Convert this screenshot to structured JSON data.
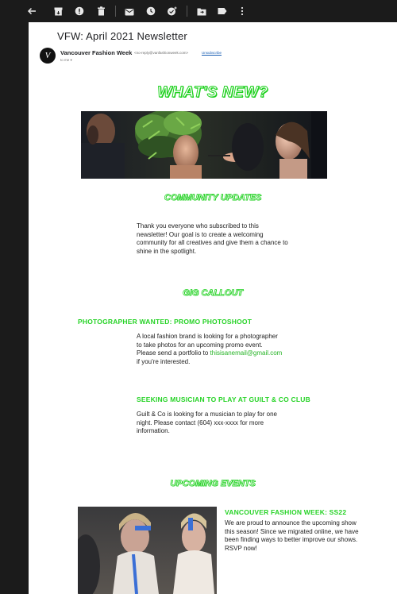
{
  "toolbar": {
    "icons": [
      "back-arrow-icon",
      "archive-icon",
      "report-spam-icon",
      "delete-icon",
      "mark-unread-icon",
      "snooze-icon",
      "add-task-icon",
      "move-to-icon",
      "label-icon",
      "more-options-icon"
    ]
  },
  "email": {
    "subject": "VFW: April 2021 Newsletter",
    "avatar_letter": "V",
    "sender_name": "Vancouver Fashion Week",
    "sender_email": "<no-reply@vanfashionweek.com>",
    "unsubscribe": "Unsubscribe",
    "to_me": "to me ▾"
  },
  "newsletter": {
    "whats_new": "WHAT'S NEW?",
    "community": {
      "title": "COMMUNITY UPDATES",
      "text": "Thank you everyone who subscribed to this newsletter! Our goal is to create a welcoming community for all creatives and give them a chance to shine in the spotlight."
    },
    "gig": {
      "title": "GIG CALLOUT",
      "photographer_title": "PHOTOGRAPHER WANTED: PROMO PHOTOSHOOT",
      "photographer_text": "A local fashion brand is looking for a photographer to take photos for an upcoming promo event. Please send a portfolio to",
      "photographer_email": "thisisanemail@gmail.com",
      "photographer_tail": "if you're interested.",
      "musician_title": "SEEKING MUSICIAN TO PLAY AT GUILT & CO CLUB",
      "musician_text": "Guilt & Co is looking for a musician to play for one night. Please contact (604) xxx-xxxx for more information."
    },
    "events": {
      "title": "UPCOMING EVENTS",
      "event_title": "VANCOUVER FASHION WEEK: SS22",
      "event_text": "We are proud to announce the upcoming show this season! Since we migrated online, we have been finding ways to better improve our shows. RSVP now!"
    }
  },
  "colors": {
    "accent_green": "#1fd11f",
    "link_green": "#27b427",
    "toolbar_bg": "#1b1b1b"
  }
}
